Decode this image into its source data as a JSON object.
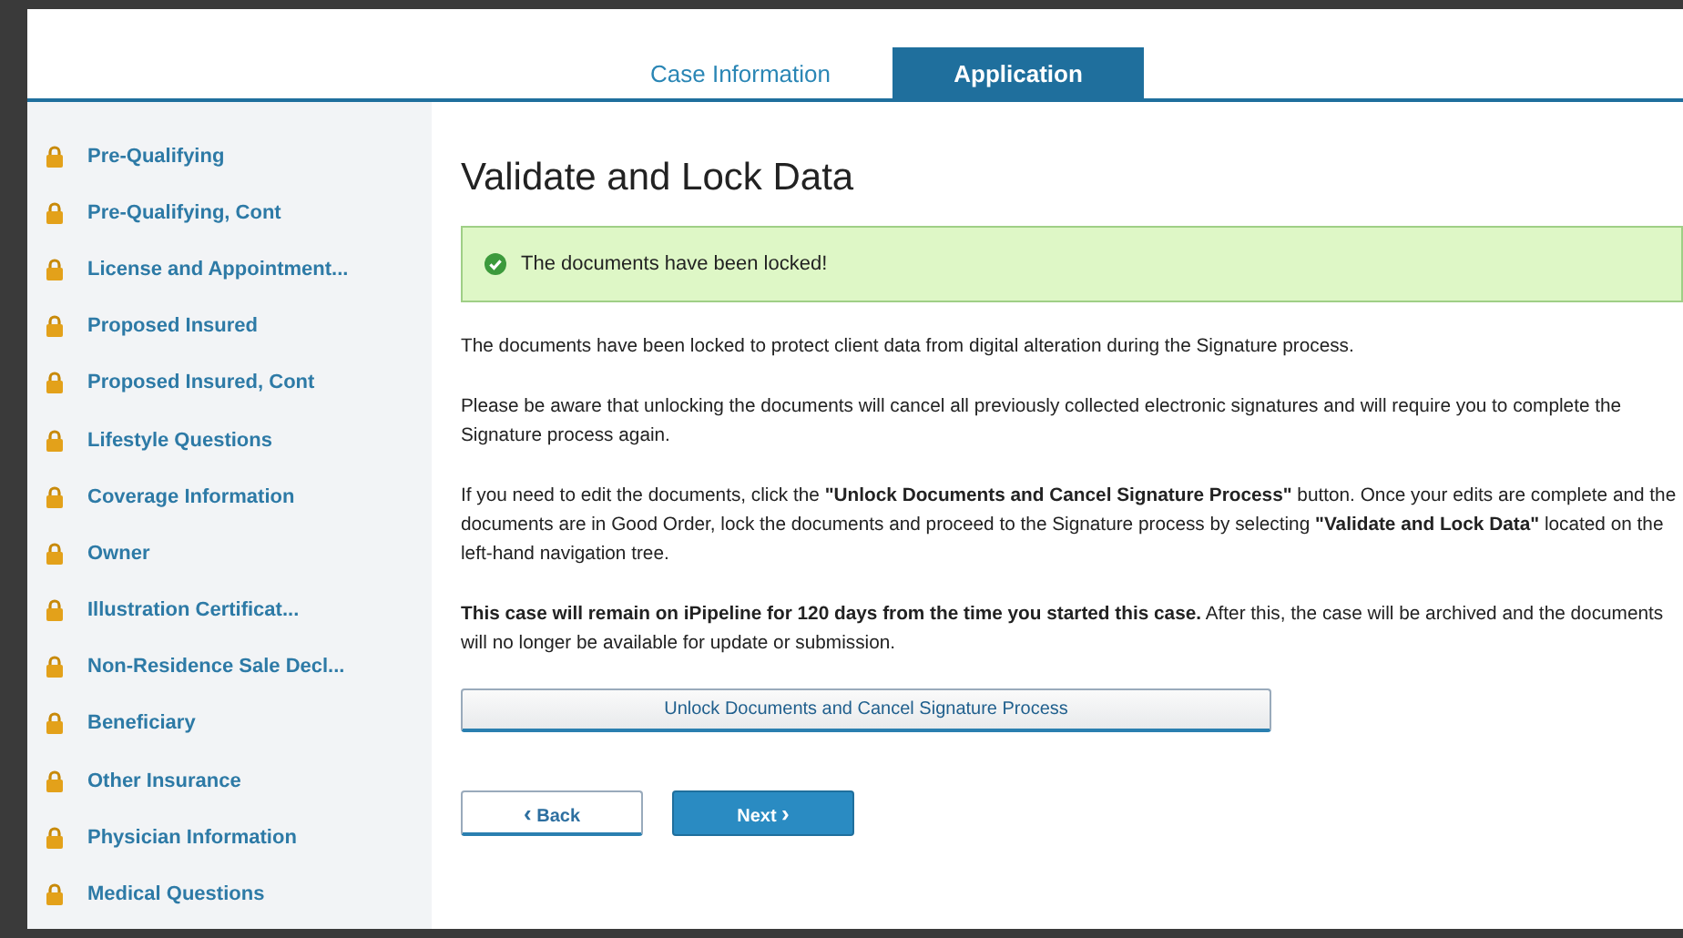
{
  "tabs": [
    {
      "label": "Case Information",
      "selected": false
    },
    {
      "label": "Application",
      "selected": true
    }
  ],
  "sidebar": {
    "items": [
      {
        "label": "Pre-Qualifying",
        "locked": true
      },
      {
        "label": "Pre-Qualifying, Cont",
        "locked": true
      },
      {
        "label": "License and Appointment...",
        "locked": true
      },
      {
        "label": "Proposed Insured",
        "locked": true
      },
      {
        "label": "Proposed Insured, Cont",
        "locked": true
      },
      {
        "label": "Lifestyle Questions",
        "locked": true
      },
      {
        "label": "Coverage Information",
        "locked": true
      },
      {
        "label": "Owner",
        "locked": true
      },
      {
        "label": "Illustration Certificat...",
        "locked": true
      },
      {
        "label": "Non-Residence Sale Decl...",
        "locked": true
      },
      {
        "label": "Beneficiary",
        "locked": true
      },
      {
        "label": "Other Insurance",
        "locked": true
      },
      {
        "label": "Physician Information",
        "locked": true
      },
      {
        "label": "Medical Questions",
        "locked": true
      }
    ]
  },
  "page_title": "Validate and Lock Data",
  "alert": {
    "kind": "success",
    "message": "The documents have been locked!"
  },
  "paragraphs": [
    "The documents have been locked to protect client data from digital alteration during the Signature process.",
    "Please be aware that unlocking the documents will cancel all previously collected electronic signatures and will require you to complete the Signature process again.",
    "If you need to edit the documents, click the **\"Unlock Documents and Cancel Signature Process\"** button. Once your edits are complete and the documents are in Good Order, lock the documents and proceed to the Signature process by selecting **\"Validate and Lock Data\"** located on the left-hand navigation tree.",
    "**This case will remain on iPipeline for 120 days from the time you started this case.** After this, the case will be archived and the documents will no longer be available for update or submission."
  ],
  "unlock_button": "Unlock Documents and Cancel Signature Process",
  "back_button": {
    "label": "Back",
    "icon": "‹"
  },
  "next_button": {
    "label": "Next",
    "icon": "›"
  }
}
